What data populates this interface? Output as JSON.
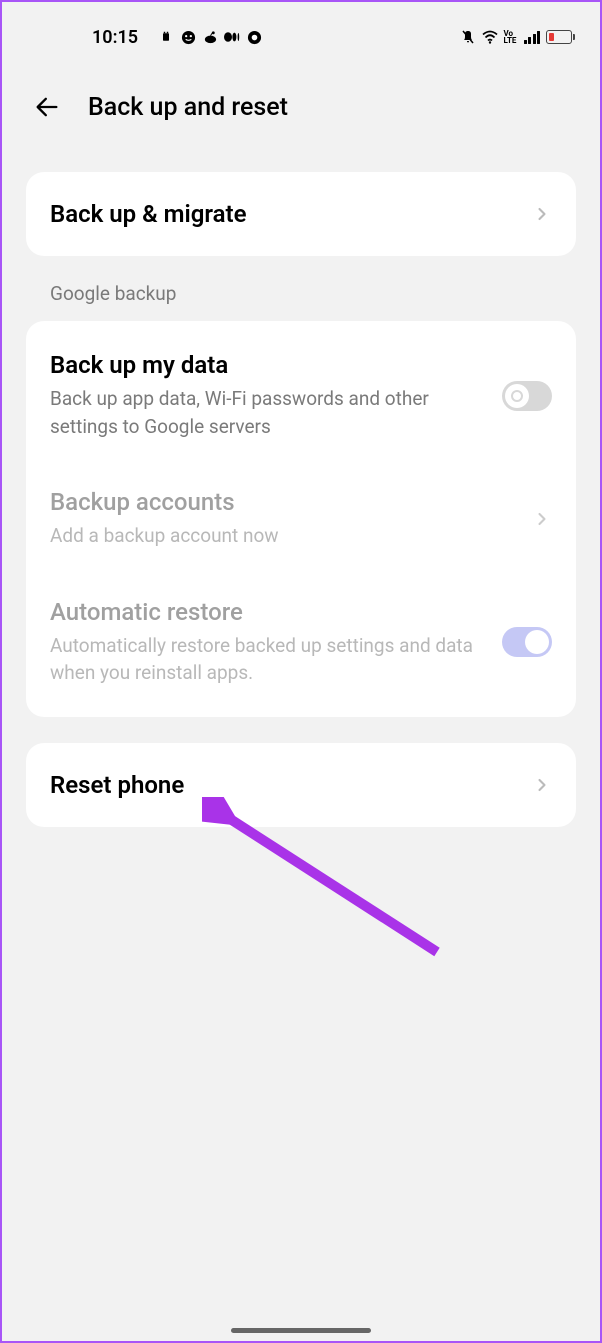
{
  "status": {
    "time": "10:15"
  },
  "header": {
    "title": "Back up and reset"
  },
  "rows": {
    "backup_migrate": {
      "title": "Back up & migrate"
    },
    "section_label": "Google backup",
    "backup_data": {
      "title": "Back up my data",
      "subtitle": "Back up app data, Wi-Fi passwords and other settings to Google servers"
    },
    "backup_accounts": {
      "title": "Backup accounts",
      "subtitle": "Add a backup account now"
    },
    "auto_restore": {
      "title": "Automatic restore",
      "subtitle": "Automatically restore backed up settings and data when you reinstall apps."
    },
    "reset_phone": {
      "title": "Reset phone"
    }
  },
  "status_right_volte": "Vo LTE"
}
